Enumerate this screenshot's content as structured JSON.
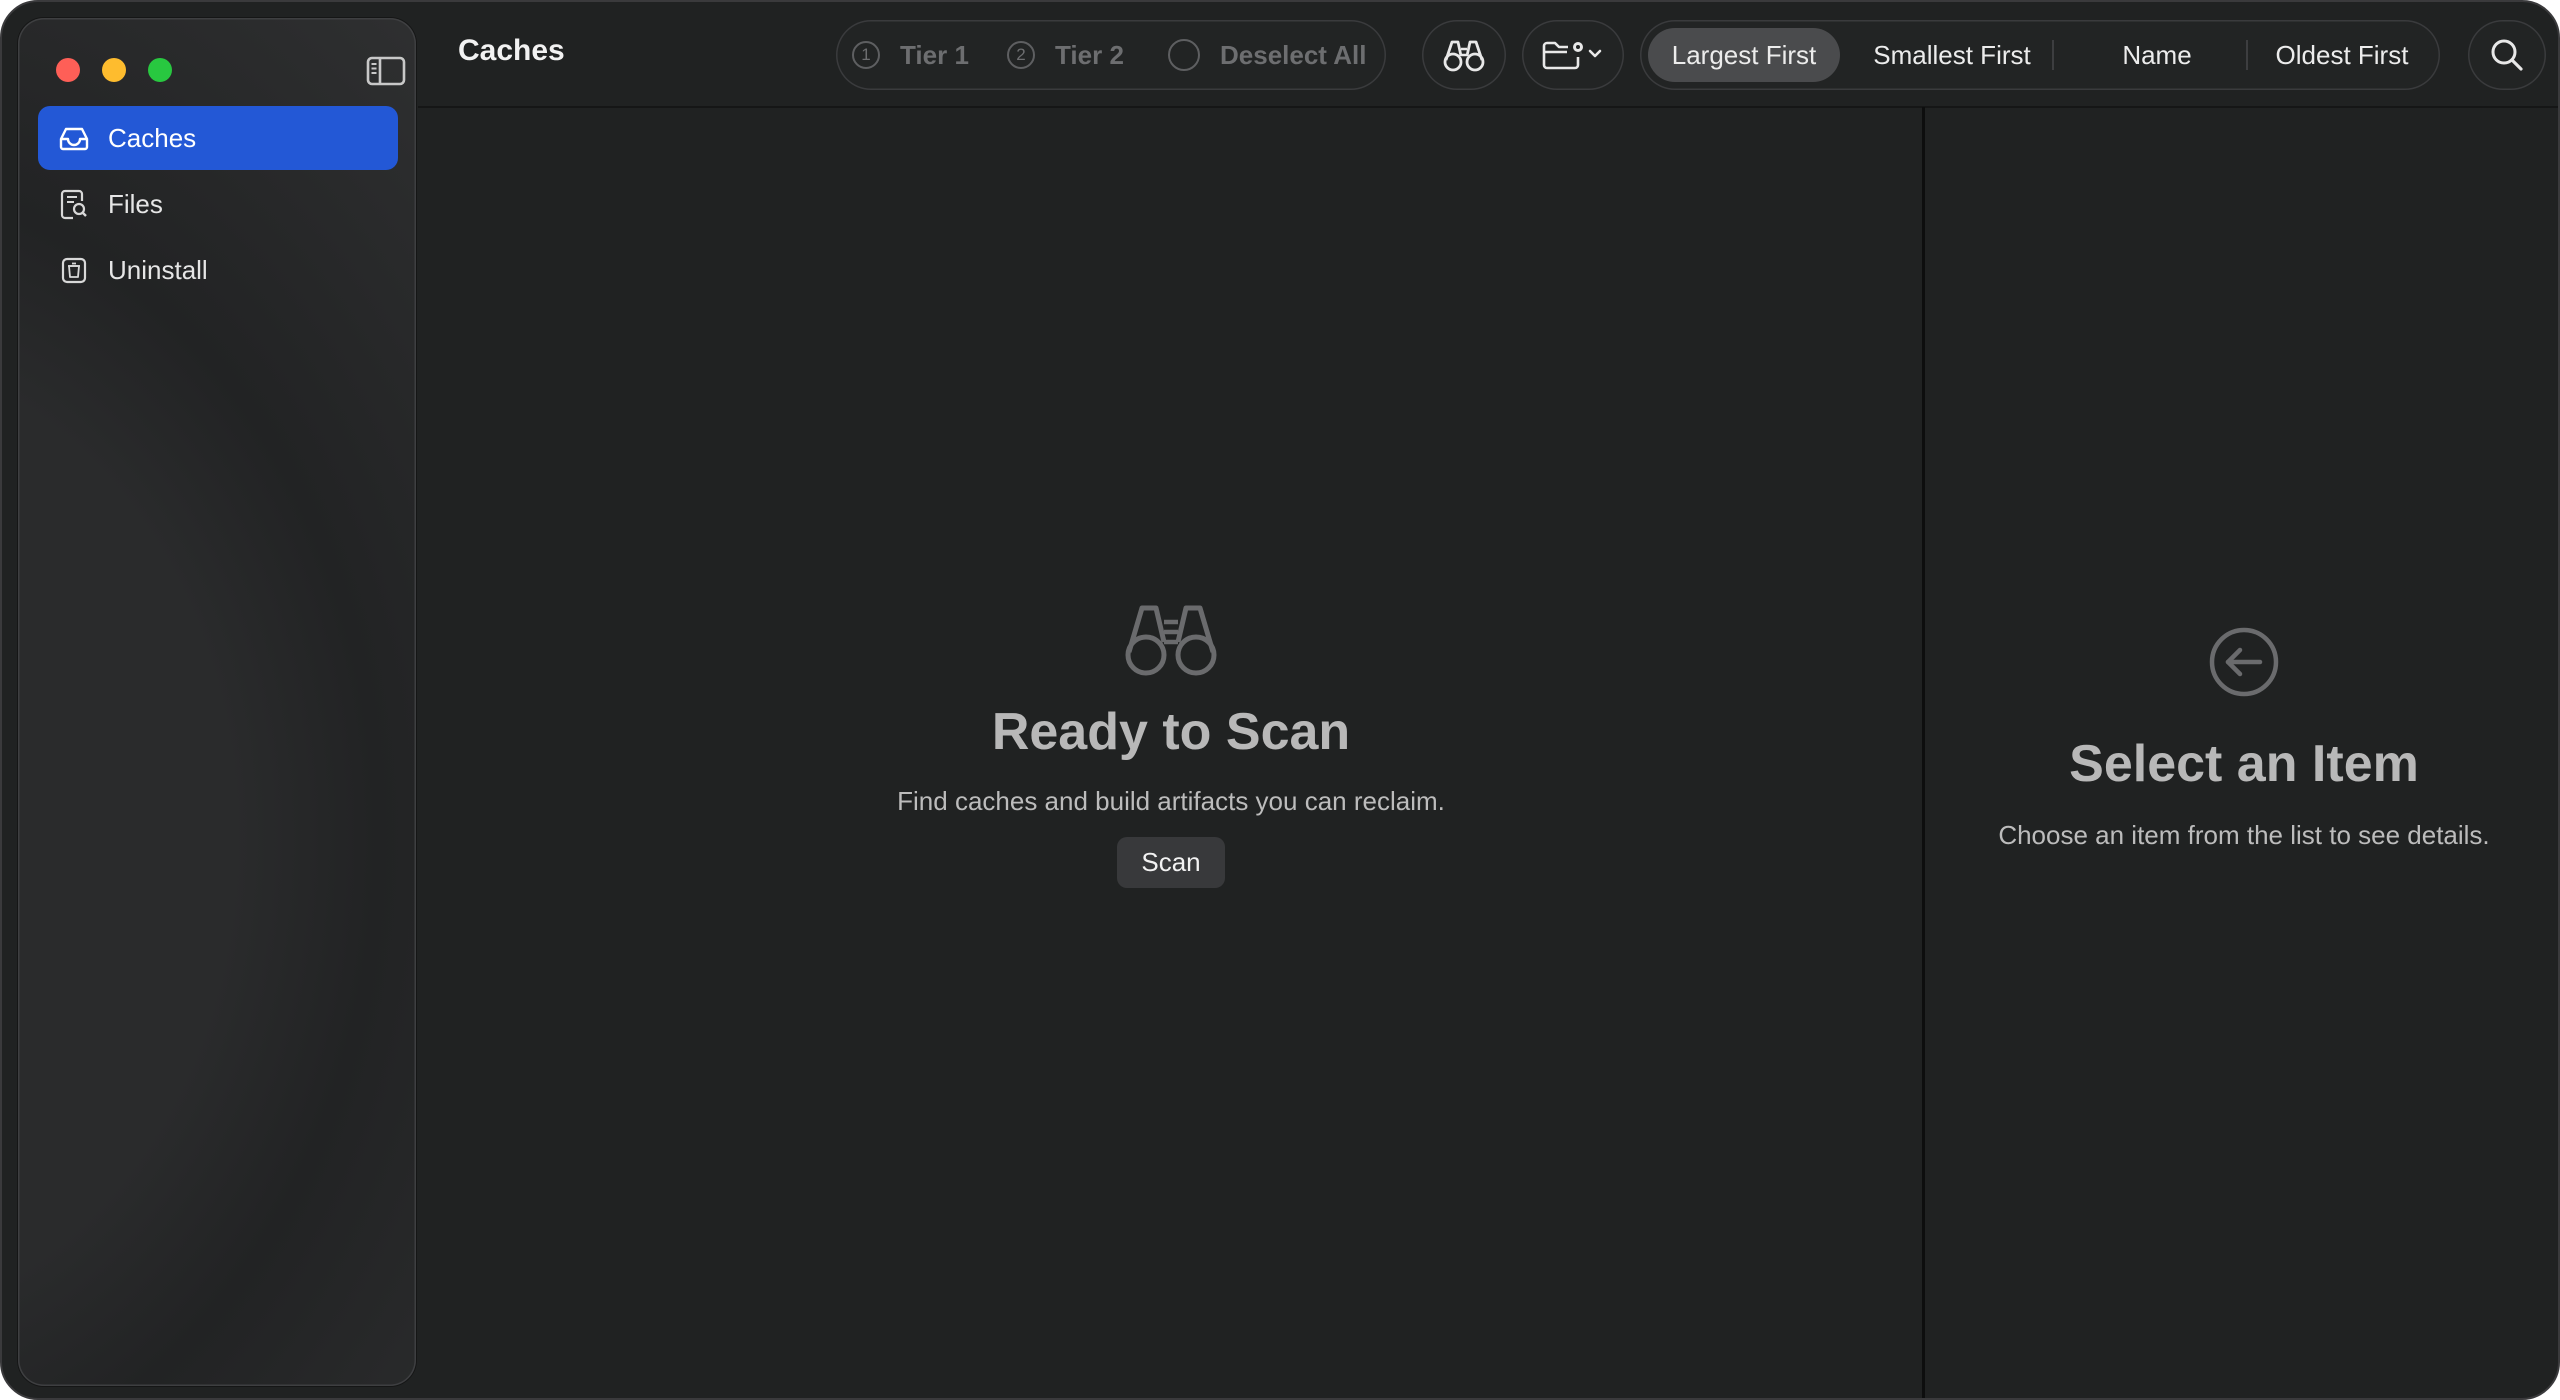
{
  "window": {
    "title": "Caches"
  },
  "sidebar": {
    "items": [
      {
        "label": "Caches",
        "icon": "tray-icon",
        "active": true
      },
      {
        "label": "Files",
        "icon": "document-search-icon",
        "active": false
      },
      {
        "label": "Uninstall",
        "icon": "trash-icon",
        "active": false
      }
    ]
  },
  "toolbar": {
    "tier1_label": "Tier 1",
    "tier1_number": "1",
    "tier2_label": "Tier 2",
    "tier2_number": "2",
    "deselect_label": "Deselect All",
    "sort_options": [
      {
        "label": "Largest First",
        "selected": true
      },
      {
        "label": "Smallest First",
        "selected": false
      },
      {
        "label": "Name",
        "selected": false
      },
      {
        "label": "Oldest First",
        "selected": false
      }
    ]
  },
  "main": {
    "empty_title": "Ready to Scan",
    "empty_subtitle": "Find caches and build artifacts you can reclaim.",
    "scan_label": "Scan"
  },
  "detail": {
    "empty_title": "Select an Item",
    "empty_subtitle": "Choose an item from the list to see details."
  },
  "colors": {
    "accent": "#2358d6",
    "window_bg": "#202222",
    "close": "#fe5f57",
    "minimize": "#febc2e",
    "maximize": "#28c840"
  }
}
